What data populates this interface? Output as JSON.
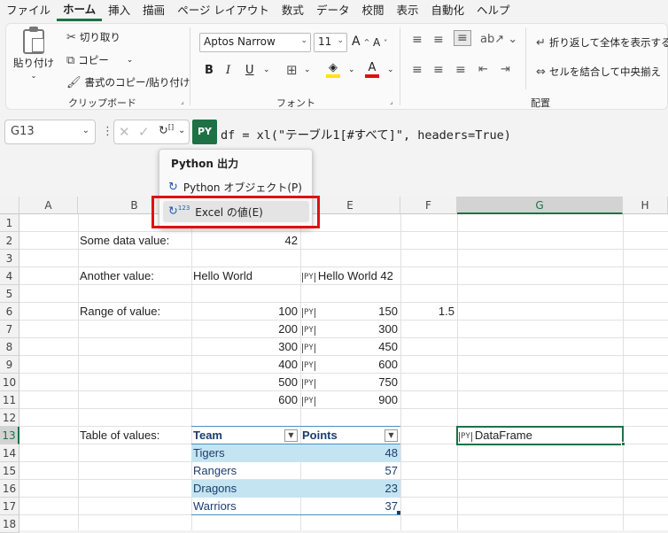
{
  "menu": [
    "ファイル",
    "ホーム",
    "挿入",
    "描画",
    "ページ レイアウト",
    "数式",
    "データ",
    "校閲",
    "表示",
    "自動化",
    "ヘルプ"
  ],
  "ribbon": {
    "paste": "貼り付け",
    "cut": "切り取り",
    "copy": "コピー",
    "format_painter": "書式のコピー/貼り付け",
    "clipboard_group": "クリップボード",
    "font_name": "Aptos Narrow",
    "font_size": "11",
    "font_group": "フォント",
    "bold": "B",
    "italic": "I",
    "underline": "U",
    "wrap_text": "折り返して全体を表示する",
    "merge_center": "セルを結合して中央揃え",
    "align_group": "配置"
  },
  "formula_bar": {
    "name_box": "G13",
    "py_badge": "PY",
    "formula": "df = xl(\"テーブル1[#すべて]\", headers=True)"
  },
  "popup": {
    "title": "Python 出力",
    "item1": "Python オブジェクト(P)",
    "item2": "Excel の値(E)"
  },
  "columns": [
    "A",
    "B",
    "C",
    "D",
    "E",
    "F",
    "G",
    "H"
  ],
  "rows": [
    "1",
    "2",
    "3",
    "4",
    "5",
    "6",
    "7",
    "8",
    "9",
    "10",
    "11",
    "12",
    "13",
    "14",
    "15",
    "16",
    "17",
    "18"
  ],
  "cells": {
    "b2": "Some data value:",
    "d2": "42",
    "b4": "Another value:",
    "c4": "Hello World",
    "e4": "Hello World 42",
    "b6": "Range of value:",
    "f6": "1.5",
    "range_left": [
      "100",
      "200",
      "300",
      "400",
      "500",
      "600"
    ],
    "range_right": [
      "150",
      "300",
      "450",
      "600",
      "750",
      "900"
    ],
    "b13": "Table of values:",
    "g13": "DataFrame",
    "table_headers": [
      "Team",
      "Points"
    ],
    "table_rows": [
      [
        "Tigers",
        "48"
      ],
      [
        "Rangers",
        "57"
      ],
      [
        "Dragons",
        "23"
      ],
      [
        "Warriors",
        "37"
      ]
    ]
  },
  "colors": {
    "accent": "#1e7145",
    "highlight": "#e01010",
    "table_band": "#c5e4f1"
  }
}
